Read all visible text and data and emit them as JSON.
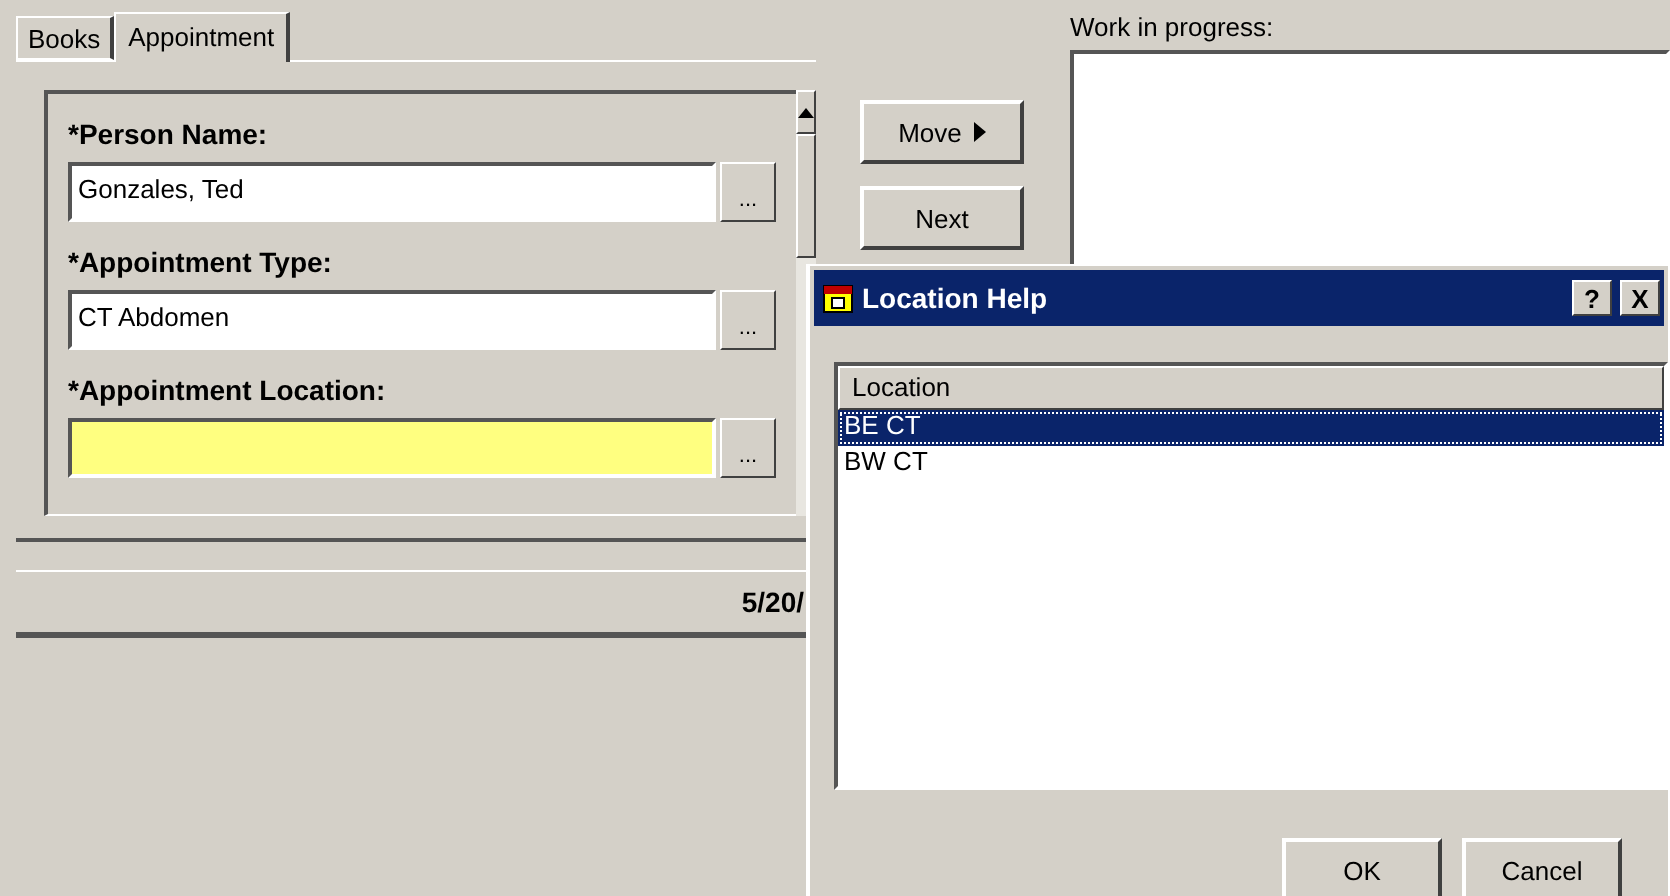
{
  "tabs": [
    {
      "label": "Books",
      "selected": false
    },
    {
      "label": "Appointment",
      "selected": true
    }
  ],
  "fields": [
    {
      "label": "*Person Name:",
      "value": "Gonzales, Ted",
      "highlighted": false,
      "lookup": "..."
    },
    {
      "label": "*Appointment Type:",
      "value": "CT Abdomen",
      "highlighted": false,
      "lookup": "..."
    },
    {
      "label": "*Appointment Location:",
      "highlighted": true,
      "lookup": "..."
    }
  ],
  "actions": [
    {
      "label": "Move",
      "kind": "arrow"
    },
    {
      "label": "Next",
      "kind": "plain"
    }
  ],
  "work_in_progress": {
    "label": "Work in progress:"
  },
  "status_bar": {
    "date": "5/20/"
  },
  "dialog": {
    "title": "Location Help",
    "help": "?",
    "close": "X",
    "columns": [
      "Location"
    ],
    "rows": [
      {
        "location": "BE CT",
        "selected": true
      },
      {
        "location": "BW CT",
        "selected": false
      }
    ],
    "buttons": [
      "OK",
      "Cancel"
    ]
  }
}
